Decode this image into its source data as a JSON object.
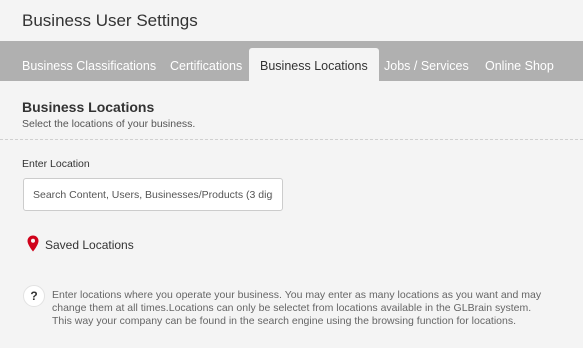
{
  "page": {
    "title": "Business User Settings"
  },
  "tabs": [
    {
      "label": "Business Classifications",
      "active": false
    },
    {
      "label": "Certifications",
      "active": false
    },
    {
      "label": "Business Locations",
      "active": true
    },
    {
      "label": "Jobs / Services",
      "active": false
    },
    {
      "label": "Online Shop",
      "active": false
    }
  ],
  "section": {
    "heading": "Business Locations",
    "subtitle": "Select the locations of your business."
  },
  "location_field": {
    "label": "Enter Location",
    "placeholder": "Search Content, Users, Businesses/Products (3 digi",
    "value": ""
  },
  "saved_locations": {
    "icon": "map-pin-icon",
    "label": "Saved Locations"
  },
  "help": {
    "icon_glyph": "?",
    "text": "Enter locations where you operate your business. You may enter as many locations as you want and may change them at all times.Locations can only be selectet from locations available in the GLBrain system. This way your company can be found in the search engine using the browsing function for locations."
  },
  "colors": {
    "tabbar_bg": "#b0b0b0",
    "page_bg": "#f4f4f4",
    "pin_red": "#d0021b"
  }
}
